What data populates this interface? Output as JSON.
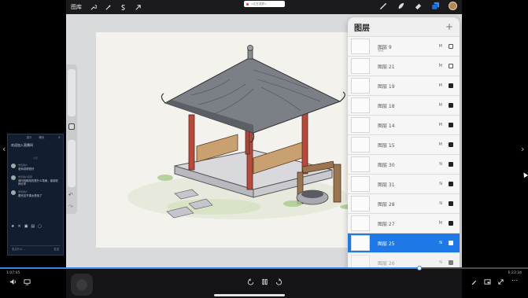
{
  "topbar": {
    "gallery_label": "图库",
    "tools": [
      "wrench-icon",
      "magic-wand-icon",
      "selection-s-icon",
      "transform-arrow-icon"
    ],
    "recording_text": "<正在录屏>"
  },
  "toolbar_right": {
    "tools": [
      "brush-icon",
      "smudge-icon",
      "eraser-icon",
      "layers-icon"
    ],
    "active_tool": "layers-icon",
    "current_color": "#b08a55"
  },
  "layers_panel": {
    "title": "图层",
    "add_button": "+",
    "layers": [
      {
        "name": "图层 9",
        "sub": "锁定",
        "blend": "M",
        "visible": false
      },
      {
        "name": "图层 21",
        "sub": "",
        "blend": "M",
        "visible": false
      },
      {
        "name": "图层 19",
        "sub": "",
        "blend": "M",
        "visible": true
      },
      {
        "name": "图层 18",
        "sub": "",
        "blend": "M",
        "visible": true
      },
      {
        "name": "图层 14",
        "sub": "",
        "blend": "M",
        "visible": true
      },
      {
        "name": "图层 15",
        "sub": "",
        "blend": "M",
        "visible": true
      },
      {
        "name": "图层 30",
        "sub": "",
        "blend": "N",
        "visible": true
      },
      {
        "name": "图层 31",
        "sub": "",
        "blend": "N",
        "visible": true
      },
      {
        "name": "图层 28",
        "sub": "",
        "blend": "N",
        "visible": true
      },
      {
        "name": "图层 27",
        "sub": "",
        "blend": "M",
        "visible": true
      },
      {
        "name": "图层 25",
        "sub": "",
        "blend": "N",
        "visible": true,
        "active": true
      },
      {
        "name": "图层 26",
        "sub": "",
        "blend": "N",
        "visible": true
      },
      {
        "name": "图层 21",
        "sub": "",
        "blend": "N",
        "visible": true
      }
    ]
  },
  "video": {
    "time_current": "1:07:05",
    "time_total": "6:23:34",
    "progress_fraction": 0.795,
    "accent": "#3a86e8"
  },
  "chat": {
    "tabs": [
      "讲义",
      "聊天"
    ],
    "title": "欢迎加入直播间",
    "section": "今天",
    "messages": [
      {
        "user": "学员用户",
        "text": "老师讲得很好"
      },
      {
        "user": "学员用户名称",
        "text": "请问线稿用的是什么笔刷，谢谢老师分享"
      },
      {
        "user": "学员用户",
        "text": "看完这节课太受用了"
      }
    ],
    "input_placeholder": "说点什么...",
    "send_label": "发送"
  }
}
